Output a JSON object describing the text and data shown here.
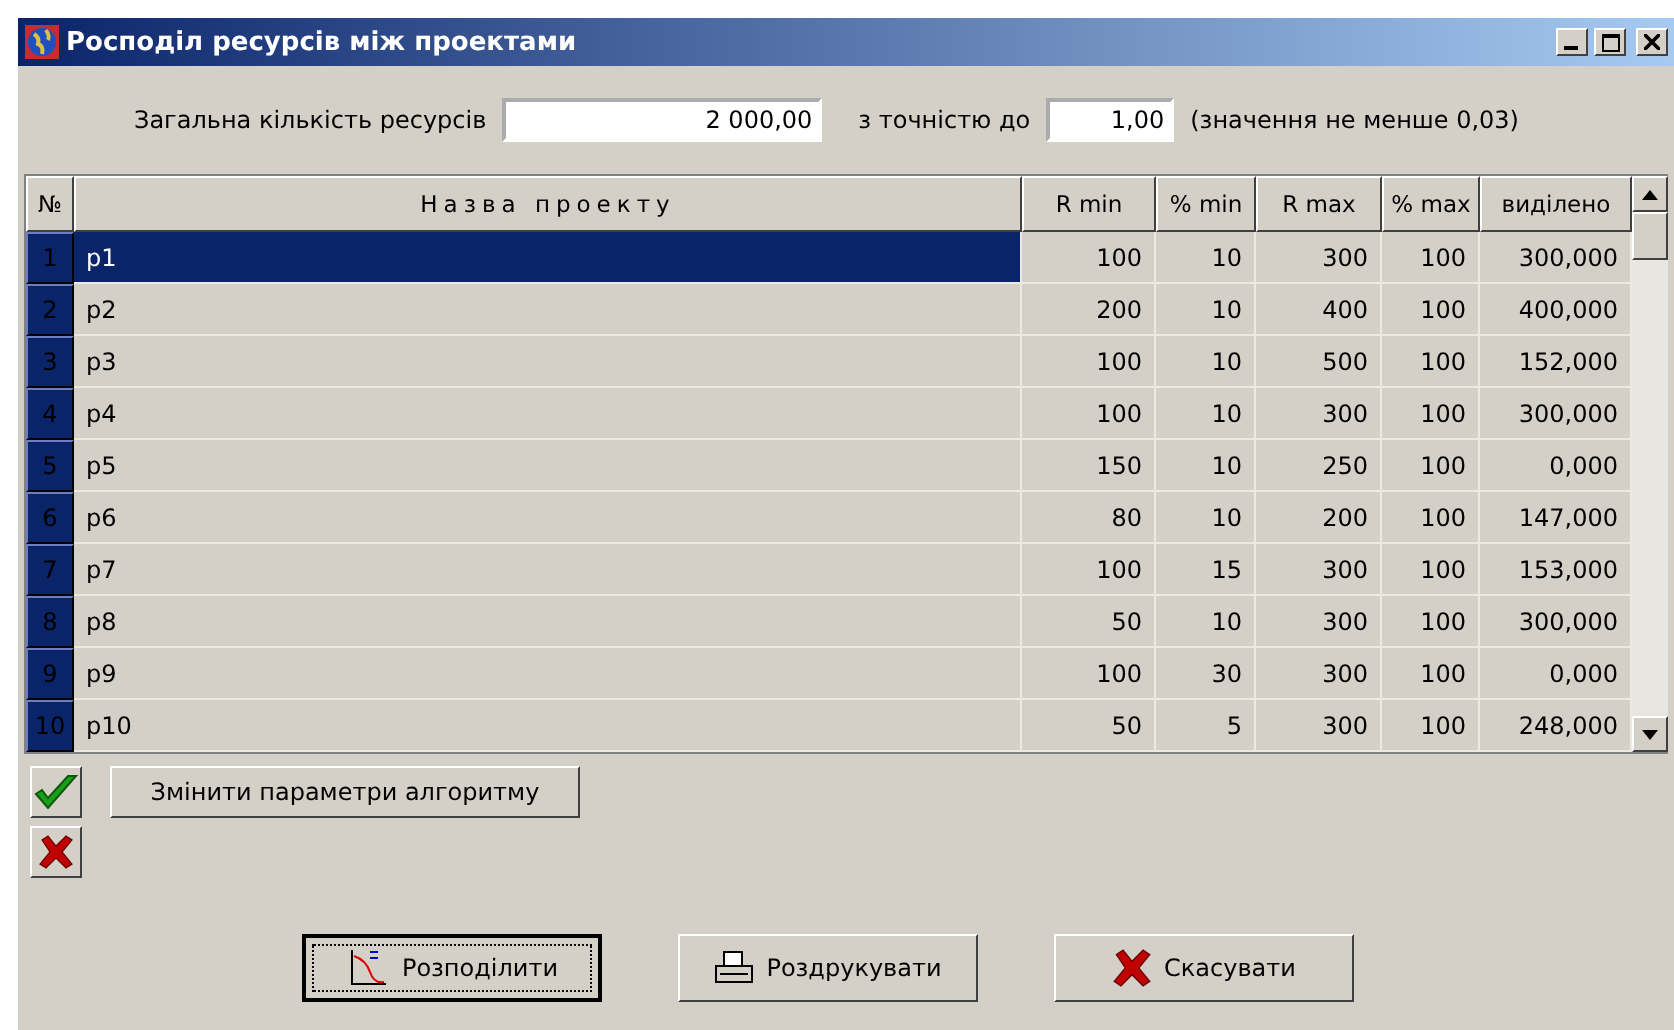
{
  "window": {
    "title": "Росподіл ресурсів між проектами"
  },
  "total": {
    "label": "Загальна кількість ресурсів",
    "value": "2 000,00"
  },
  "precision": {
    "label": "з точністю до",
    "value": "1,00",
    "hint": "(значення не менше 0,03)"
  },
  "table": {
    "columns": [
      "№",
      "Назва проекту",
      "R min",
      "% min",
      "R max",
      "% max",
      "виділено"
    ],
    "rows": [
      {
        "number": "1",
        "name": "p1",
        "r_min": "100",
        "pct_min": "10",
        "r_max": "300",
        "pct_max": "100",
        "allocated": "300,000",
        "selected": true
      },
      {
        "number": "2",
        "name": "p2",
        "r_min": "200",
        "pct_min": "10",
        "r_max": "400",
        "pct_max": "100",
        "allocated": "400,000",
        "selected": false
      },
      {
        "number": "3",
        "name": "p3",
        "r_min": "100",
        "pct_min": "10",
        "r_max": "500",
        "pct_max": "100",
        "allocated": "152,000",
        "selected": false
      },
      {
        "number": "4",
        "name": "p4",
        "r_min": "100",
        "pct_min": "10",
        "r_max": "300",
        "pct_max": "100",
        "allocated": "300,000",
        "selected": false
      },
      {
        "number": "5",
        "name": "p5",
        "r_min": "150",
        "pct_min": "10",
        "r_max": "250",
        "pct_max": "100",
        "allocated": "0,000",
        "selected": false
      },
      {
        "number": "6",
        "name": "p6",
        "r_min": "80",
        "pct_min": "10",
        "r_max": "200",
        "pct_max": "100",
        "allocated": "147,000",
        "selected": false
      },
      {
        "number": "7",
        "name": "p7",
        "r_min": "100",
        "pct_min": "15",
        "r_max": "300",
        "pct_max": "100",
        "allocated": "153,000",
        "selected": false
      },
      {
        "number": "8",
        "name": "p8",
        "r_min": "50",
        "pct_min": "10",
        "r_max": "300",
        "pct_max": "100",
        "allocated": "300,000",
        "selected": false
      },
      {
        "number": "9",
        "name": "p9",
        "r_min": "100",
        "pct_min": "30",
        "r_max": "300",
        "pct_max": "100",
        "allocated": "0,000",
        "selected": false
      },
      {
        "number": "10",
        "name": "p10",
        "r_min": "50",
        "pct_min": "5",
        "r_max": "300",
        "pct_max": "100",
        "allocated": "248,000",
        "selected": false
      }
    ]
  },
  "change_params_button": "Змінити параметри алгоритму",
  "buttons": [
    {
      "kind": "distribute",
      "label": "Розподілити",
      "focused": true
    },
    {
      "kind": "print",
      "label": "Роздрукувати",
      "focused": false
    },
    {
      "kind": "cancel",
      "label": "Скасувати",
      "focused": false
    }
  ]
}
